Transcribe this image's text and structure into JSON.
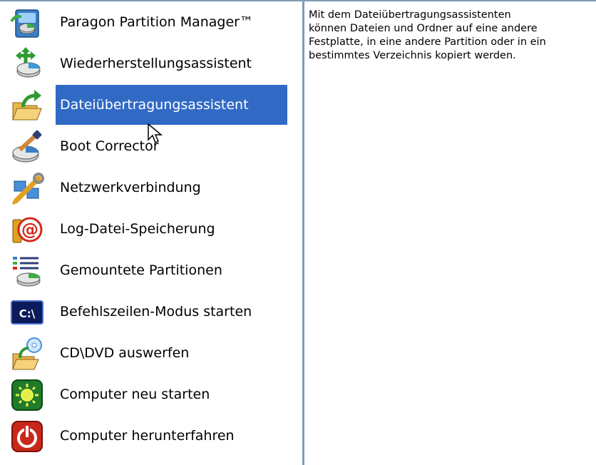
{
  "menu": {
    "items": [
      {
        "label": "Paragon Partition Manager™",
        "icon": "partition-manager-icon"
      },
      {
        "label": "Wiederherstellungsassistent",
        "icon": "restore-wizard-icon"
      },
      {
        "label": "Dateiübertragungsassistent",
        "icon": "file-transfer-icon",
        "selected": true
      },
      {
        "label": "Boot Corrector",
        "icon": "boot-corrector-icon"
      },
      {
        "label": "Netzwerkverbindung",
        "icon": "network-connection-icon"
      },
      {
        "label": "Log-Datei-Speicherung",
        "icon": "log-save-icon"
      },
      {
        "label": "Gemountete Partitionen",
        "icon": "mounted-partitions-icon"
      },
      {
        "label": "Befehlszeilen-Modus starten",
        "icon": "command-line-icon"
      },
      {
        "label": "CD\\DVD auswerfen",
        "icon": "eject-cd-icon"
      },
      {
        "label": "Computer neu starten",
        "icon": "restart-icon"
      },
      {
        "label": "Computer herunterfahren",
        "icon": "shutdown-icon"
      }
    ]
  },
  "description": {
    "text": "Mit dem Dateiübertragungsassistenten\nkönnen Dateien und Ordner auf eine andere\nFestplatte, in eine andere Partition oder in ein\nbestimmtes Verzeichnis kopiert werden."
  },
  "colors": {
    "selection": "#316ac5",
    "border": "#7f9db9"
  }
}
